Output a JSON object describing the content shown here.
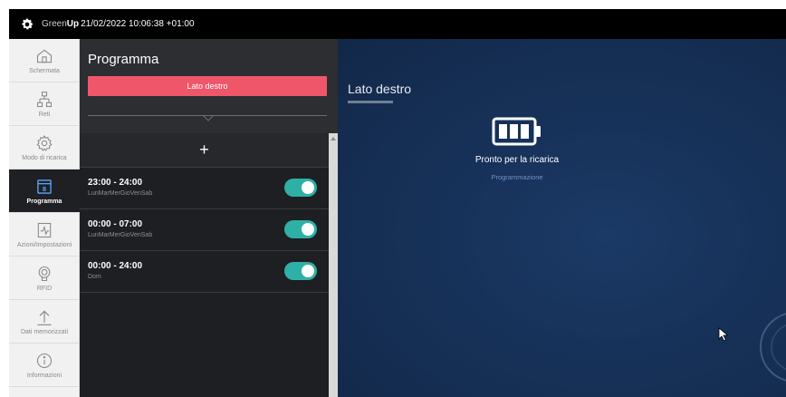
{
  "topbar": {
    "brand_light": "Green",
    "brand_bold": "Up",
    "datetime": "21/02/2022 10:06:38 +01:00"
  },
  "nav": {
    "items": [
      {
        "label": "Schermata",
        "icon": "home-icon"
      },
      {
        "label": "Reti",
        "icon": "network-icon"
      },
      {
        "label": "Modo di ricarica",
        "icon": "gear-icon"
      },
      {
        "label": "Programma",
        "icon": "calendar-icon"
      },
      {
        "label": "Azioni/Impostazioni",
        "icon": "actions-icon"
      },
      {
        "label": "RFID",
        "icon": "rfid-icon"
      },
      {
        "label": "Dati memorizzati",
        "icon": "upload-icon"
      },
      {
        "label": "Informazioni",
        "icon": "info-icon"
      }
    ],
    "active_index": 3
  },
  "panel": {
    "title": "Programma",
    "side_button": "Lato destro",
    "add_label": "+",
    "schedules": [
      {
        "time": "23:00 - 24:00",
        "days": "LunMarMerGioVenSab",
        "enabled": true
      },
      {
        "time": "00:00 - 07:00",
        "days": "LunMarMerGioVenSab",
        "enabled": true
      },
      {
        "time": "00:00 - 24:00",
        "days": "Dom",
        "enabled": true
      }
    ]
  },
  "main": {
    "title": "Lato destro",
    "status": "Pronto per la ricarica",
    "sub": "Programmazione"
  },
  "colors": {
    "accent_red": "#f0566a",
    "toggle_on": "#2fb0a7",
    "main_bg": "#17325a"
  }
}
